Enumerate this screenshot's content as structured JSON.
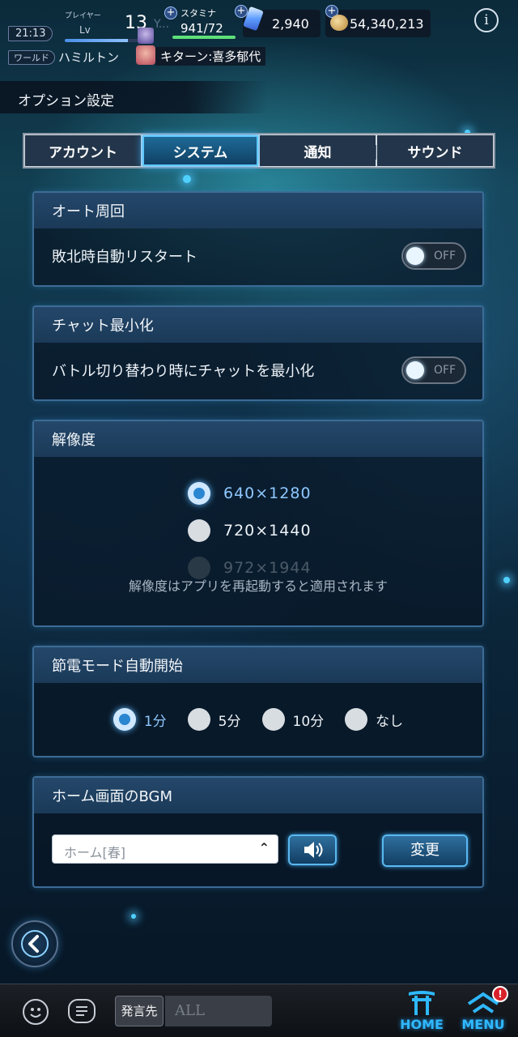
{
  "status_bar": {
    "time": "21:13",
    "player_label": "プレイヤー",
    "lv_label": "Lv",
    "level": "13",
    "level_progress": 0.75,
    "player_name_partial": "Y...",
    "stamina_label": "スタミナ",
    "stamina_value": "941/72",
    "gems": "2,940",
    "coins": "54,340,213",
    "world_label": "ワールド",
    "world_name": "ハミルトン",
    "character": "キターン:喜多郁代"
  },
  "header": {
    "title": "オプション設定"
  },
  "tabs": [
    {
      "label": "アカウント",
      "active": false
    },
    {
      "label": "システム",
      "active": true
    },
    {
      "label": "通知",
      "active": false
    },
    {
      "label": "サウンド",
      "active": false
    }
  ],
  "auto_loop": {
    "title": "オート周回",
    "label": "敗北時自動リスタート",
    "toggle": "OFF"
  },
  "chat_minimize": {
    "title": "チャット最小化",
    "label": "バトル切り替わり時にチャットを最小化",
    "toggle": "OFF"
  },
  "resolution": {
    "title": "解像度",
    "options": [
      {
        "label": "640×1280",
        "state": "selected"
      },
      {
        "label": "720×1440",
        "state": "unselected"
      },
      {
        "label": "972×1944",
        "state": "disabled"
      }
    ],
    "note": "解像度はアプリを再起動すると適用されます"
  },
  "power_save": {
    "title": "節電モード自動開始",
    "options": [
      {
        "label": "1分",
        "state": "selected"
      },
      {
        "label": "5分",
        "state": "unselected"
      },
      {
        "label": "10分",
        "state": "unselected"
      },
      {
        "label": "なし",
        "state": "unselected"
      }
    ]
  },
  "home_bgm": {
    "title": "ホーム画面のBGM",
    "selected": "ホーム[春]",
    "change_label": "変更"
  },
  "bottom_bar": {
    "target_label": "発言先",
    "chat_placeholder": "ALL",
    "home_label": "HOME",
    "menu_label": "MENU",
    "menu_badge": "!"
  },
  "colors": {
    "accent": "#2fb8ff",
    "panel_border": "#3c6c96",
    "selected_radio": "#2a86d0",
    "badge": "#d8222a"
  }
}
